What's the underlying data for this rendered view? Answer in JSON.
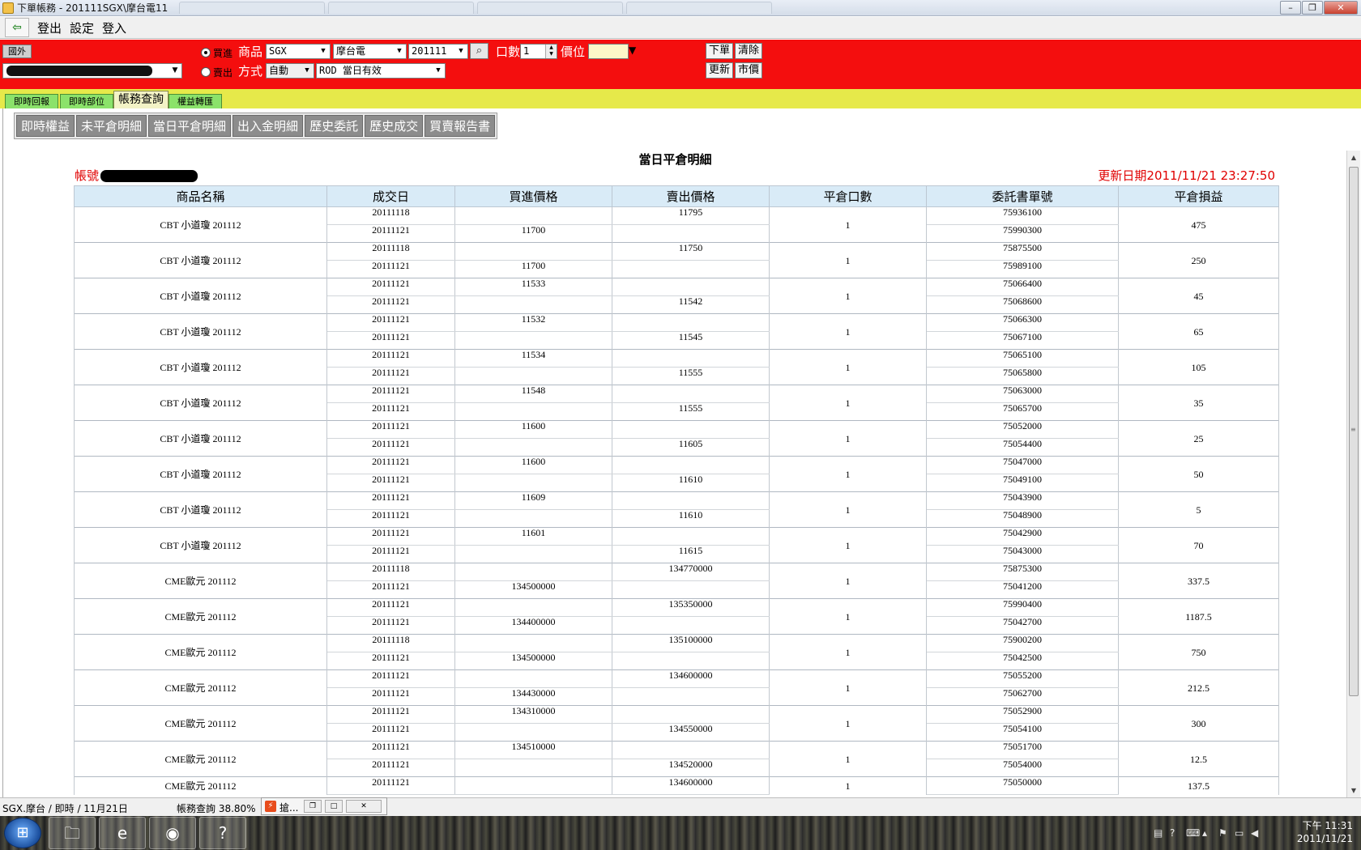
{
  "window": {
    "title": "下單帳務 - 201111SGX\\摩台電11",
    "controls": [
      "–",
      "❐",
      "✕"
    ]
  },
  "menu": {
    "exit_icon": "exit-icon",
    "items": [
      "登出",
      "設定",
      "登入"
    ]
  },
  "order_panel": {
    "market_tag": "國外",
    "side_buy": "買進",
    "side_sell": "賣出",
    "product_label": "商品",
    "product_exchange": "SGX",
    "product_name": "摩台電",
    "product_month": "201111",
    "qty_label": "口數",
    "qty_value": "1",
    "price_label": "價位",
    "method_label": "方式",
    "method_value": "自動",
    "tif_value": "ROD 當日有效",
    "btn_order": "下單",
    "btn_clear": "清除",
    "btn_refresh": "更新",
    "btn_market": "市價"
  },
  "main_tabs": [
    "即時回報",
    "即時部位",
    "帳務查詢",
    "權益轉匯"
  ],
  "sub_tabs": [
    "即時權益",
    "未平倉明細",
    "當日平倉明細",
    "出入金明細",
    "歷史委託",
    "歷史成交",
    "買賣報告書"
  ],
  "report": {
    "title": "當日平倉明細",
    "account_label": "帳號",
    "update_label": "更新日期2011/11/21 23:27:50",
    "columns": [
      "商品名稱",
      "成交日",
      "買進價格",
      "賣出價格",
      "平倉口數",
      "委託書單號",
      "平倉損益"
    ],
    "groups": [
      {
        "product": "CBT 小道瓊 201112",
        "qty": "1",
        "pnl": "475",
        "rows": [
          [
            "20111118",
            "",
            "11795",
            "75936100"
          ],
          [
            "20111121",
            "11700",
            "",
            "75990300"
          ]
        ]
      },
      {
        "product": "CBT 小道瓊 201112",
        "qty": "1",
        "pnl": "250",
        "rows": [
          [
            "20111118",
            "",
            "11750",
            "75875500"
          ],
          [
            "20111121",
            "11700",
            "",
            "75989100"
          ]
        ]
      },
      {
        "product": "CBT 小道瓊 201112",
        "qty": "1",
        "pnl": "45",
        "rows": [
          [
            "20111121",
            "11533",
            "",
            "75066400"
          ],
          [
            "20111121",
            "",
            "11542",
            "75068600"
          ]
        ]
      },
      {
        "product": "CBT 小道瓊 201112",
        "qty": "1",
        "pnl": "65",
        "rows": [
          [
            "20111121",
            "11532",
            "",
            "75066300"
          ],
          [
            "20111121",
            "",
            "11545",
            "75067100"
          ]
        ]
      },
      {
        "product": "CBT 小道瓊 201112",
        "qty": "1",
        "pnl": "105",
        "rows": [
          [
            "20111121",
            "11534",
            "",
            "75065100"
          ],
          [
            "20111121",
            "",
            "11555",
            "75065800"
          ]
        ]
      },
      {
        "product": "CBT 小道瓊 201112",
        "qty": "1",
        "pnl": "35",
        "rows": [
          [
            "20111121",
            "11548",
            "",
            "75063000"
          ],
          [
            "20111121",
            "",
            "11555",
            "75065700"
          ]
        ]
      },
      {
        "product": "CBT 小道瓊 201112",
        "qty": "1",
        "pnl": "25",
        "rows": [
          [
            "20111121",
            "11600",
            "",
            "75052000"
          ],
          [
            "20111121",
            "",
            "11605",
            "75054400"
          ]
        ]
      },
      {
        "product": "CBT 小道瓊 201112",
        "qty": "1",
        "pnl": "50",
        "rows": [
          [
            "20111121",
            "11600",
            "",
            "75047000"
          ],
          [
            "20111121",
            "",
            "11610",
            "75049100"
          ]
        ]
      },
      {
        "product": "CBT 小道瓊 201112",
        "qty": "1",
        "pnl": "5",
        "rows": [
          [
            "20111121",
            "11609",
            "",
            "75043900"
          ],
          [
            "20111121",
            "",
            "11610",
            "75048900"
          ]
        ]
      },
      {
        "product": "CBT 小道瓊 201112",
        "qty": "1",
        "pnl": "70",
        "rows": [
          [
            "20111121",
            "11601",
            "",
            "75042900"
          ],
          [
            "20111121",
            "",
            "11615",
            "75043000"
          ]
        ]
      },
      {
        "product": "CME歐元 201112",
        "qty": "1",
        "pnl": "337.5",
        "rows": [
          [
            "20111118",
            "",
            "134770000",
            "75875300"
          ],
          [
            "20111121",
            "134500000",
            "",
            "75041200"
          ]
        ]
      },
      {
        "product": "CME歐元 201112",
        "qty": "1",
        "pnl": "1187.5",
        "rows": [
          [
            "20111121",
            "",
            "135350000",
            "75990400"
          ],
          [
            "20111121",
            "134400000",
            "",
            "75042700"
          ]
        ]
      },
      {
        "product": "CME歐元 201112",
        "qty": "1",
        "pnl": "750",
        "rows": [
          [
            "20111118",
            "",
            "135100000",
            "75900200"
          ],
          [
            "20111121",
            "134500000",
            "",
            "75042500"
          ]
        ]
      },
      {
        "product": "CME歐元 201112",
        "qty": "1",
        "pnl": "212.5",
        "rows": [
          [
            "20111121",
            "",
            "134600000",
            "75055200"
          ],
          [
            "20111121",
            "134430000",
            "",
            "75062700"
          ]
        ]
      },
      {
        "product": "CME歐元 201112",
        "qty": "1",
        "pnl": "300",
        "rows": [
          [
            "20111121",
            "134310000",
            "",
            "75052900"
          ],
          [
            "20111121",
            "",
            "134550000",
            "75054100"
          ]
        ]
      },
      {
        "product": "CME歐元 201112",
        "qty": "1",
        "pnl": "12.5",
        "rows": [
          [
            "20111121",
            "134510000",
            "",
            "75051700"
          ],
          [
            "20111121",
            "",
            "134520000",
            "75054000"
          ]
        ]
      },
      {
        "product": "CME歐元 201112",
        "qty": "1",
        "pnl": "137.5",
        "rows": [
          [
            "20111121",
            "",
            "134600000",
            "75050000"
          ]
        ]
      }
    ]
  },
  "statusbar": {
    "left": "SGX.摩台 / 即時 / 11月21日",
    "middle": "帳務查詢  38.80%",
    "float_title": "搶..."
  },
  "taskbar": {
    "tray_time": "下午 11:31",
    "tray_date": "2011/11/21"
  }
}
